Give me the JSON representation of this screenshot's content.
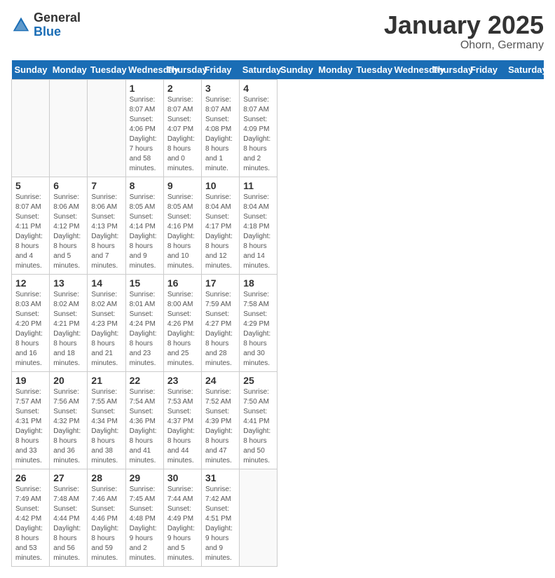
{
  "logo": {
    "general": "General",
    "blue": "Blue"
  },
  "header": {
    "title": "January 2025",
    "subtitle": "Ohorn, Germany"
  },
  "weekdays": [
    "Sunday",
    "Monday",
    "Tuesday",
    "Wednesday",
    "Thursday",
    "Friday",
    "Saturday"
  ],
  "weeks": [
    [
      {
        "day": "",
        "info": ""
      },
      {
        "day": "",
        "info": ""
      },
      {
        "day": "",
        "info": ""
      },
      {
        "day": "1",
        "info": "Sunrise: 8:07 AM\nSunset: 4:06 PM\nDaylight: 7 hours\nand 58 minutes."
      },
      {
        "day": "2",
        "info": "Sunrise: 8:07 AM\nSunset: 4:07 PM\nDaylight: 8 hours\nand 0 minutes."
      },
      {
        "day": "3",
        "info": "Sunrise: 8:07 AM\nSunset: 4:08 PM\nDaylight: 8 hours\nand 1 minute."
      },
      {
        "day": "4",
        "info": "Sunrise: 8:07 AM\nSunset: 4:09 PM\nDaylight: 8 hours\nand 2 minutes."
      }
    ],
    [
      {
        "day": "5",
        "info": "Sunrise: 8:07 AM\nSunset: 4:11 PM\nDaylight: 8 hours\nand 4 minutes."
      },
      {
        "day": "6",
        "info": "Sunrise: 8:06 AM\nSunset: 4:12 PM\nDaylight: 8 hours\nand 5 minutes."
      },
      {
        "day": "7",
        "info": "Sunrise: 8:06 AM\nSunset: 4:13 PM\nDaylight: 8 hours\nand 7 minutes."
      },
      {
        "day": "8",
        "info": "Sunrise: 8:05 AM\nSunset: 4:14 PM\nDaylight: 8 hours\nand 9 minutes."
      },
      {
        "day": "9",
        "info": "Sunrise: 8:05 AM\nSunset: 4:16 PM\nDaylight: 8 hours\nand 10 minutes."
      },
      {
        "day": "10",
        "info": "Sunrise: 8:04 AM\nSunset: 4:17 PM\nDaylight: 8 hours\nand 12 minutes."
      },
      {
        "day": "11",
        "info": "Sunrise: 8:04 AM\nSunset: 4:18 PM\nDaylight: 8 hours\nand 14 minutes."
      }
    ],
    [
      {
        "day": "12",
        "info": "Sunrise: 8:03 AM\nSunset: 4:20 PM\nDaylight: 8 hours\nand 16 minutes."
      },
      {
        "day": "13",
        "info": "Sunrise: 8:02 AM\nSunset: 4:21 PM\nDaylight: 8 hours\nand 18 minutes."
      },
      {
        "day": "14",
        "info": "Sunrise: 8:02 AM\nSunset: 4:23 PM\nDaylight: 8 hours\nand 21 minutes."
      },
      {
        "day": "15",
        "info": "Sunrise: 8:01 AM\nSunset: 4:24 PM\nDaylight: 8 hours\nand 23 minutes."
      },
      {
        "day": "16",
        "info": "Sunrise: 8:00 AM\nSunset: 4:26 PM\nDaylight: 8 hours\nand 25 minutes."
      },
      {
        "day": "17",
        "info": "Sunrise: 7:59 AM\nSunset: 4:27 PM\nDaylight: 8 hours\nand 28 minutes."
      },
      {
        "day": "18",
        "info": "Sunrise: 7:58 AM\nSunset: 4:29 PM\nDaylight: 8 hours\nand 30 minutes."
      }
    ],
    [
      {
        "day": "19",
        "info": "Sunrise: 7:57 AM\nSunset: 4:31 PM\nDaylight: 8 hours\nand 33 minutes."
      },
      {
        "day": "20",
        "info": "Sunrise: 7:56 AM\nSunset: 4:32 PM\nDaylight: 8 hours\nand 36 minutes."
      },
      {
        "day": "21",
        "info": "Sunrise: 7:55 AM\nSunset: 4:34 PM\nDaylight: 8 hours\nand 38 minutes."
      },
      {
        "day": "22",
        "info": "Sunrise: 7:54 AM\nSunset: 4:36 PM\nDaylight: 8 hours\nand 41 minutes."
      },
      {
        "day": "23",
        "info": "Sunrise: 7:53 AM\nSunset: 4:37 PM\nDaylight: 8 hours\nand 44 minutes."
      },
      {
        "day": "24",
        "info": "Sunrise: 7:52 AM\nSunset: 4:39 PM\nDaylight: 8 hours\nand 47 minutes."
      },
      {
        "day": "25",
        "info": "Sunrise: 7:50 AM\nSunset: 4:41 PM\nDaylight: 8 hours\nand 50 minutes."
      }
    ],
    [
      {
        "day": "26",
        "info": "Sunrise: 7:49 AM\nSunset: 4:42 PM\nDaylight: 8 hours\nand 53 minutes."
      },
      {
        "day": "27",
        "info": "Sunrise: 7:48 AM\nSunset: 4:44 PM\nDaylight: 8 hours\nand 56 minutes."
      },
      {
        "day": "28",
        "info": "Sunrise: 7:46 AM\nSunset: 4:46 PM\nDaylight: 8 hours\nand 59 minutes."
      },
      {
        "day": "29",
        "info": "Sunrise: 7:45 AM\nSunset: 4:48 PM\nDaylight: 9 hours\nand 2 minutes."
      },
      {
        "day": "30",
        "info": "Sunrise: 7:44 AM\nSunset: 4:49 PM\nDaylight: 9 hours\nand 5 minutes."
      },
      {
        "day": "31",
        "info": "Sunrise: 7:42 AM\nSunset: 4:51 PM\nDaylight: 9 hours\nand 9 minutes."
      },
      {
        "day": "",
        "info": ""
      }
    ]
  ]
}
